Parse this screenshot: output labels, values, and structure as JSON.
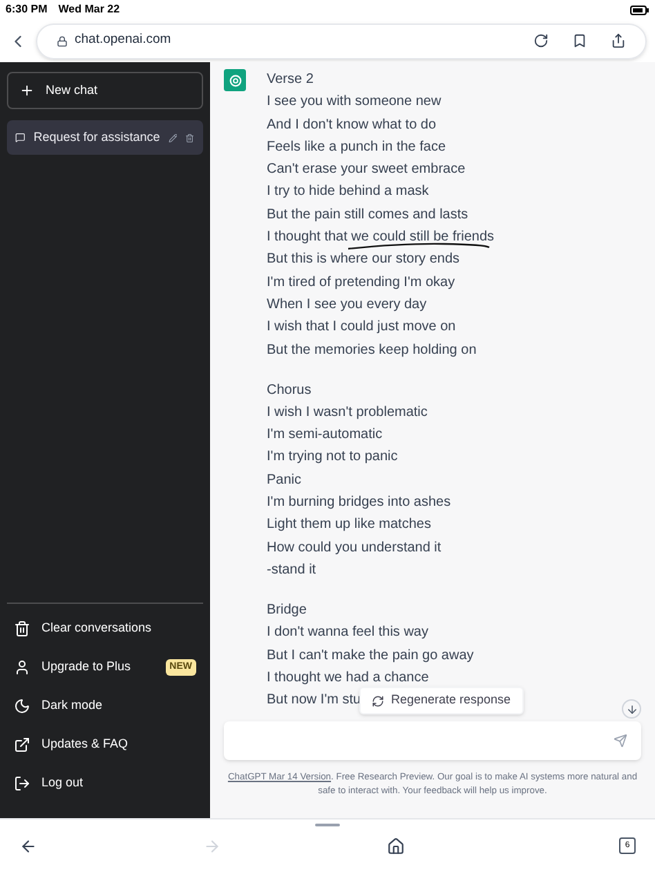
{
  "status_bar": {
    "time": "6:30 PM",
    "date": "Wed Mar 22"
  },
  "browser": {
    "url": "chat.openai.com",
    "tab_count": "6",
    "forward_disabled": true
  },
  "sidebar": {
    "new_chat": "New chat",
    "conversations": [
      {
        "title": "Request for assistance",
        "selected": true
      }
    ],
    "menu": [
      {
        "label": "Clear conversations",
        "kind": "trash"
      },
      {
        "label": "Upgrade to Plus",
        "kind": "user",
        "badge": "NEW"
      },
      {
        "label": "Dark mode",
        "kind": "moon"
      },
      {
        "label": "Updates & FAQ",
        "kind": "external"
      },
      {
        "label": "Log out",
        "kind": "logout"
      }
    ]
  },
  "message": {
    "stanzas": [
      {
        "heading": "Verse 2",
        "lines": [
          {
            "text": "I see you with someone new"
          },
          {
            "text": "And I don't know what to do"
          },
          {
            "text": "Feels like a punch in the face"
          },
          {
            "text": "Can't erase your sweet embrace"
          },
          {
            "text": "I try to hide behind a mask"
          },
          {
            "text": "But the pain still comes and lasts"
          },
          {
            "text": "I thought that we could still be friends",
            "underlined": true
          },
          {
            "text": "But this is where our story ends"
          },
          {
            "text": "I'm tired of pretending I'm okay"
          },
          {
            "text": "When I see you every day"
          },
          {
            "text": "I wish that I could just move on"
          },
          {
            "text": "But the memories keep holding on"
          }
        ]
      },
      {
        "heading": "Chorus",
        "lines": [
          {
            "text": "I wish I wasn't problematic"
          },
          {
            "text": "I'm semi-automatic"
          },
          {
            "text": "I'm trying not to panic"
          },
          {
            "text": "Panic"
          },
          {
            "text": "I'm burning bridges into ashes"
          },
          {
            "text": "Light them up like matches"
          },
          {
            "text": "How could you understand it"
          },
          {
            "text": "-stand it"
          }
        ]
      },
      {
        "heading": "Bridge",
        "lines": [
          {
            "text": "I don't wanna feel this way"
          },
          {
            "text": "But I can't make the pain go away"
          },
          {
            "text": "I thought we had a chance"
          },
          {
            "text": "But now I'm stu"
          }
        ]
      }
    ]
  },
  "regenerate": "Regenerate response",
  "footer": {
    "link": "ChatGPT Mar 14 Version",
    "text": ". Free Research Preview. Our goal is to make AI systems more natural and safe to interact with. Your feedback will help us improve."
  }
}
